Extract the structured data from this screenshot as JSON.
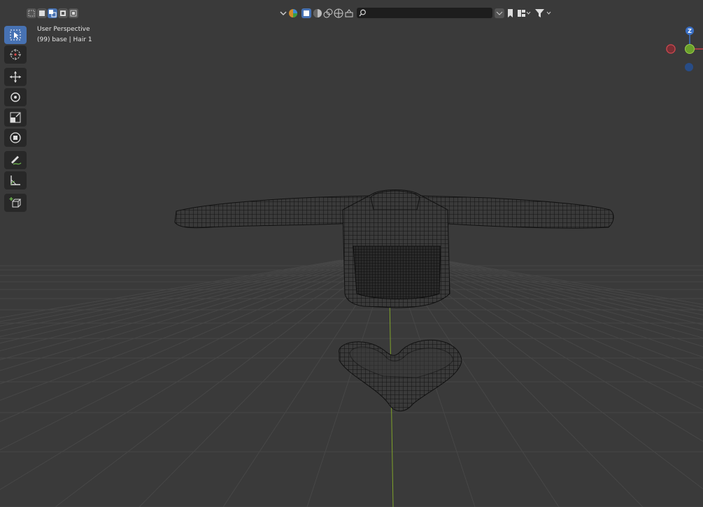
{
  "viewport": {
    "mode": "User Perspective",
    "object_info": "(99) base | Hair 1"
  },
  "header": {
    "search_placeholder": "",
    "search_value": ""
  },
  "gizmo": {
    "z_label": "Z",
    "x_color": "#c8434b",
    "y_color": "#6a9f2b",
    "z_color": "#3a70c6"
  },
  "colors": {
    "accent": "#4772b3",
    "background": "#3a3a3a"
  },
  "icons": {
    "toolbar": [
      "select-box-icon",
      "cursor-icon",
      "move-icon",
      "rotate-icon",
      "scale-icon",
      "transform-icon",
      "annotate-icon",
      "measure-icon",
      "add-cube-icon"
    ]
  }
}
